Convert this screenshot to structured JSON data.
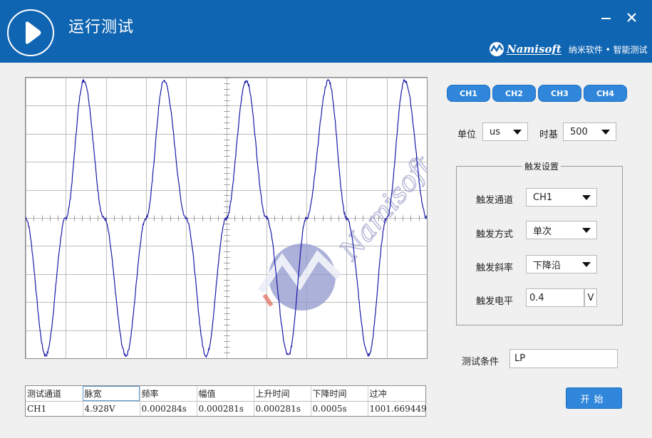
{
  "app": {
    "title": "运行测试",
    "brand_name": "Namisoft",
    "brand_tagline": "纳米软件 • 智能测试",
    "watermark_text": "Namisoft"
  },
  "window_controls": {
    "minimize": "—",
    "close": "✕"
  },
  "icons": {
    "play": "play-icon",
    "brand_logo": "namisoft-logo-icon",
    "dropdown": "chevron-down-icon"
  },
  "colors": {
    "titlebar": "#1065b2",
    "button": "#2f86da",
    "waveform": "#1a1aa8",
    "grid": "#bdbdbd",
    "background": "#f0f0f0"
  },
  "channels": [
    "CH1",
    "CH2",
    "CH3",
    "CH4"
  ],
  "timebase": {
    "unit_label": "单位",
    "unit_value": "us",
    "base_label": "时基",
    "base_value": "500"
  },
  "trigger": {
    "legend": "触发设置",
    "channel_label": "触发通道",
    "channel_value": "CH1",
    "mode_label": "触发方式",
    "mode_value": "单次",
    "slope_label": "触发斜率",
    "slope_value": "下降沿",
    "level_label": "触发电平",
    "level_value": "0.4",
    "level_unit": "V"
  },
  "test_condition": {
    "label": "测试条件",
    "value": "LP"
  },
  "start_button": "开始",
  "measurements": {
    "headers": [
      "测试通道",
      "脉宽",
      "频率",
      "幅值",
      "上升时间",
      "下降时间",
      "过冲"
    ],
    "values": [
      "CH1",
      "4.928V",
      "0.000284s",
      "0.000281s",
      "0.000281s",
      "0.0005s",
      "1001.669449"
    ]
  },
  "chart_data": {
    "type": "line",
    "title": "",
    "xlabel": "",
    "ylabel": "",
    "divisions": {
      "x": 10,
      "y": 10
    },
    "grid": true,
    "xlim": [
      0,
      10
    ],
    "ylim": [
      -5,
      5
    ],
    "series": [
      {
        "x": [
          0,
          0.5,
          1.0,
          1.45,
          1.95,
          2.5,
          3.0,
          3.45,
          4.0,
          4.5,
          5.0,
          5.5,
          6.0,
          6.55,
          7.0,
          7.55,
          8.0,
          8.55,
          9.0,
          9.45,
          10.0
        ],
        "values": [
          0,
          -4.9,
          0,
          4.9,
          0,
          -4.9,
          0,
          4.9,
          0,
          -4.9,
          0,
          4.9,
          0,
          -4.9,
          0,
          4.9,
          0,
          -4.9,
          0,
          4.9,
          0
        ]
      }
    ]
  }
}
